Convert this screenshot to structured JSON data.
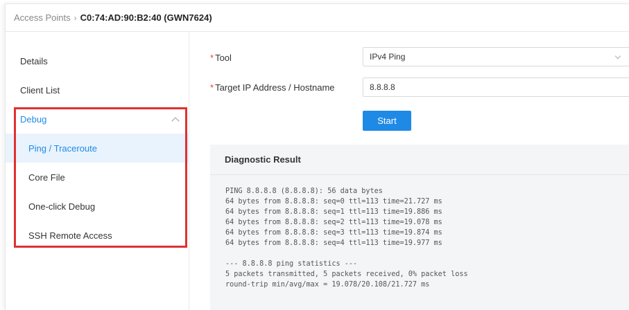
{
  "breadcrumb": {
    "parent": "Access Points",
    "separator": "›",
    "current": "C0:74:AD:90:B2:40 (GWN7624)"
  },
  "sidebar": {
    "items": [
      {
        "label": "Details"
      },
      {
        "label": "Client List"
      }
    ],
    "debug_group": {
      "label": "Debug",
      "expanded": true,
      "children": [
        {
          "label": "Ping / Traceroute",
          "active": true
        },
        {
          "label": "Core File"
        },
        {
          "label": "One-click Debug"
        },
        {
          "label": "SSH Remote Access"
        }
      ]
    }
  },
  "form": {
    "required_mark": "*",
    "tool_label": "Tool",
    "tool_value": "IPv4 Ping",
    "target_label": "Target IP Address / Hostname",
    "target_value": "8.8.8.8",
    "start_label": "Start"
  },
  "result": {
    "title": "Diagnostic Result",
    "lines": [
      "PING 8.8.8.8 (8.8.8.8): 56 data bytes",
      "64 bytes from 8.8.8.8: seq=0 ttl=113 time=21.727 ms",
      "64 bytes from 8.8.8.8: seq=1 ttl=113 time=19.886 ms",
      "64 bytes from 8.8.8.8: seq=2 ttl=113 time=19.078 ms",
      "64 bytes from 8.8.8.8: seq=3 ttl=113 time=19.874 ms",
      "64 bytes from 8.8.8.8: seq=4 ttl=113 time=19.977 ms",
      "",
      "--- 8.8.8.8 ping statistics ---",
      "5 packets transmitted, 5 packets received, 0% packet loss",
      "round-trip min/avg/max = 19.078/20.108/21.727 ms"
    ]
  },
  "colors": {
    "accent": "#1f8ae6",
    "active_bg": "#e8f3fd",
    "highlight_border": "#e03030",
    "required": "#e8442e"
  }
}
